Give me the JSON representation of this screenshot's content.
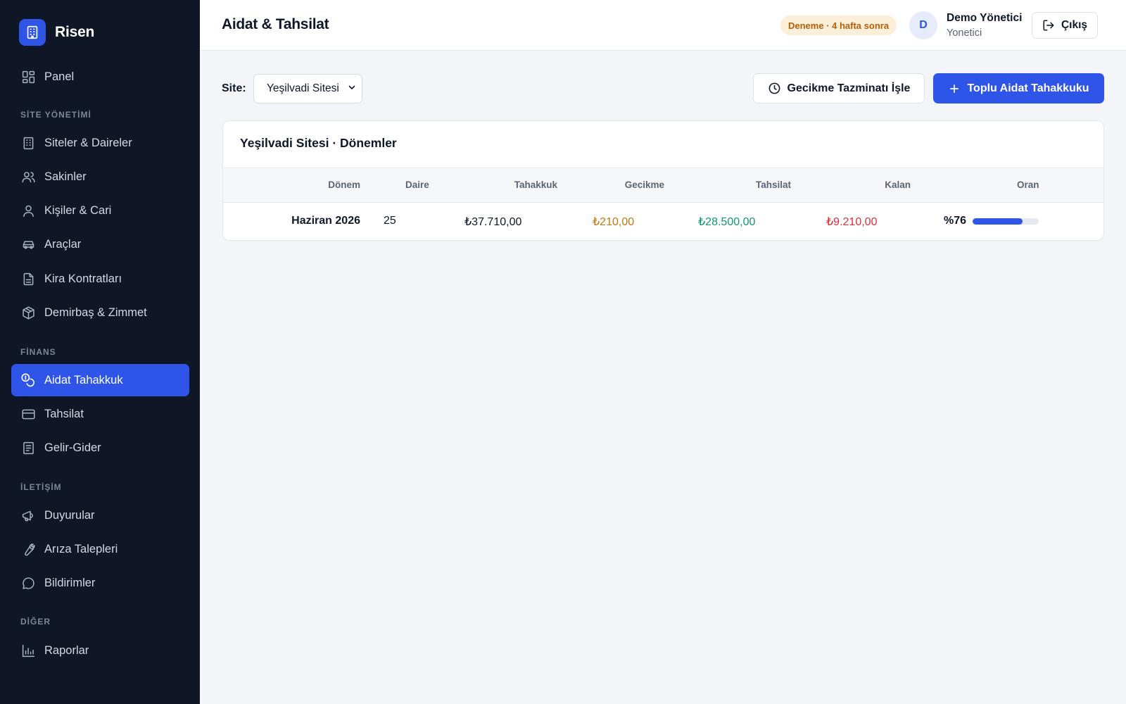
{
  "app": {
    "name": "Risen"
  },
  "sidebar": {
    "panel": "Panel",
    "sections": [
      {
        "title": "SİTE YÖNETİMİ",
        "items": [
          "Siteler & Daireler",
          "Sakinler",
          "Kişiler & Cari",
          "Araçlar",
          "Kira Kontratları",
          "Demirbaş & Zimmet"
        ]
      },
      {
        "title": "FİNANS",
        "items": [
          "Aidat Tahakkuk",
          "Tahsilat",
          "Gelir-Gider"
        ]
      },
      {
        "title": "İLETİŞİM",
        "items": [
          "Duyurular",
          "Arıza Talepleri",
          "Bildirimler"
        ]
      },
      {
        "title": "DİĞER",
        "items": [
          "Raporlar"
        ]
      }
    ],
    "active_item": "Aidat Tahakkuk"
  },
  "header": {
    "title": "Aidat & Tahsilat",
    "trial_badge": "Deneme · 4 hafta sonra",
    "avatar_initial": "D",
    "user_name": "Demo Yönetici",
    "user_role": "Yonetici",
    "logout_label": "Çıkış"
  },
  "toolbar": {
    "site_label": "Site:",
    "site_selected": "Yeşilvadi Sitesi",
    "late_fee_button": "Gecikme Tazminatı İşle",
    "bulk_accrual_button": "Toplu Aidat Tahakkuku"
  },
  "periods": {
    "title": "Yeşilvadi Sitesi · Dönemler",
    "columns": [
      "Dönem",
      "Daire",
      "Tahakkuk",
      "Gecikme",
      "Tahsilat",
      "Kalan",
      "Oran"
    ],
    "rows": [
      {
        "period": "Haziran 2026",
        "units": "25",
        "accrual": "₺37.710,00",
        "late_fee": "₺210,00",
        "collected": "₺28.500,00",
        "remaining": "₺9.210,00",
        "rate": "%76",
        "rate_value": 76
      }
    ]
  },
  "colors": {
    "accent": "#2f55e8",
    "sidebar_bg": "#0f1626",
    "late": "#c27a0e",
    "collected": "#0f9a6a",
    "remaining": "#dc2f3a"
  }
}
